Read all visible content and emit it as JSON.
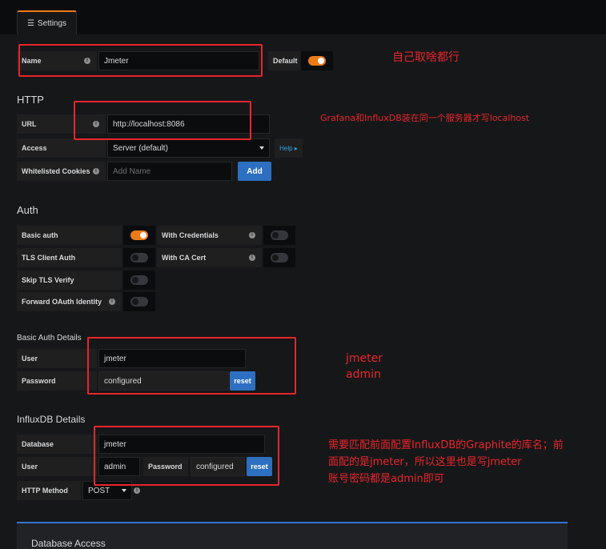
{
  "tab": {
    "icon": "settings-sliders-icon",
    "label": "Settings"
  },
  "name_row": {
    "label": "Name",
    "value": "Jmeter",
    "default_label": "Default",
    "default_on": true
  },
  "http": {
    "title": "HTTP",
    "url_label": "URL",
    "url_value": "http://localhost:8086",
    "access_label": "Access",
    "access_value": "Server (default)",
    "help_label": "Help ▸",
    "cookies_label": "Whitelisted Cookies",
    "cookies_placeholder": "Add Name",
    "add_label": "Add"
  },
  "auth": {
    "title": "Auth",
    "basic_auth": {
      "label": "Basic auth",
      "on": true
    },
    "with_credentials": {
      "label": "With Credentials",
      "on": false
    },
    "tls_client_auth": {
      "label": "TLS Client Auth",
      "on": false
    },
    "with_ca_cert": {
      "label": "With CA Cert",
      "on": false
    },
    "skip_tls_verify": {
      "label": "Skip TLS Verify",
      "on": false
    },
    "forward_oauth": {
      "label": "Forward OAuth Identity",
      "on": false
    }
  },
  "basic_auth_details": {
    "title": "Basic Auth Details",
    "user_label": "User",
    "user_value": "jmeter",
    "password_label": "Password",
    "password_value": "configured",
    "reset_label": "reset"
  },
  "influxdb_details": {
    "title": "InfluxDB Details",
    "database_label": "Database",
    "database_value": "jmeter",
    "user_label": "User",
    "user_value": "admin",
    "password_label": "Password",
    "password_value": "configured",
    "reset_label": "reset",
    "method_label": "HTTP Method",
    "method_value": "POST"
  },
  "db_access": {
    "title": "Database Access"
  },
  "annotations": {
    "a1": "自己取啥都行",
    "a2": "Grafana和InfluxDB装在同一个服务器才写localhost",
    "a3_line1": "jmeter",
    "a3_line2": "admin",
    "a4_line1": "需要匹配前面配置InfluxDB的Graphite的库名；前",
    "a4_line2": "面配的是jmeter，所以这里也是写jmeter",
    "a4_line3": "账号密码都是admin即可"
  },
  "colors": {
    "accent_orange": "#eb7b18",
    "button_blue": "#2d6fc0",
    "annotation_red": "#e8252a",
    "panel_bg": "#161719"
  }
}
